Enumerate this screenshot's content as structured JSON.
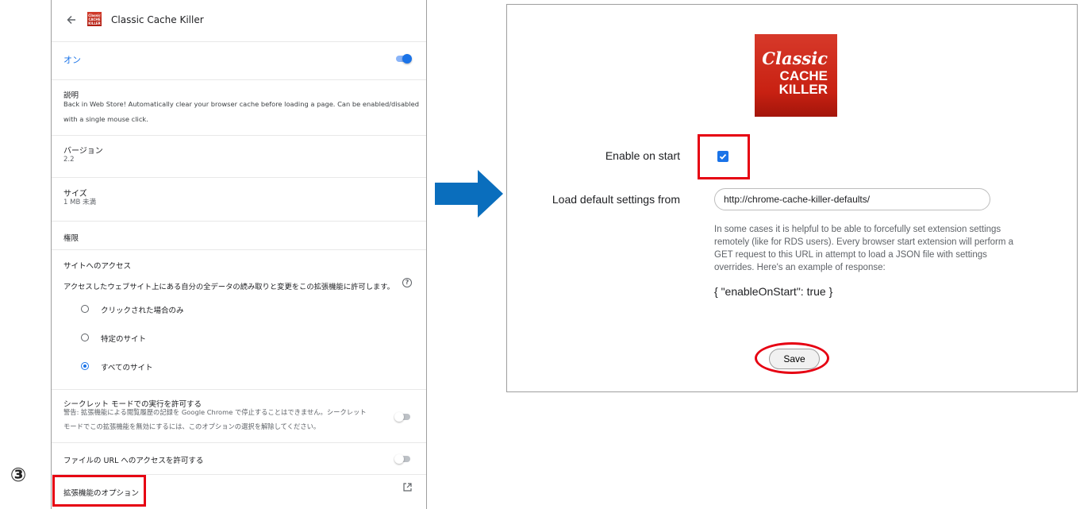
{
  "left": {
    "title": "Classic Cache Killer",
    "icon_text": [
      "Classic",
      "CACHE",
      "KILLER"
    ],
    "on_label": "オン",
    "description_heading": "説明",
    "description_text": [
      "Back in Web Store! Automatically clear your browser cache before loading a page. Can be enabled/disabled",
      "with a single mouse click."
    ],
    "version_heading": "バージョン",
    "version_value": "2.2",
    "size_heading": "サイズ",
    "size_value": "1 MB 未満",
    "permissions_heading": "権限",
    "site_access_heading": "サイトへのアクセス",
    "site_access_text": "アクセスしたウェブサイト上にある自分の全データの読み取りと変更をこの拡張機能に許可します。",
    "help_icon_glyph": "?",
    "radio_options": [
      "クリックされた場合のみ",
      "特定のサイト",
      "すべてのサイト"
    ],
    "radio_selected_index": 2,
    "incognito_heading": "シークレット モードでの実行を許可する",
    "incognito_text": [
      "警告: 拡張機能による閲覧履歴の記録を Google Chrome で停止することはできません。シークレット",
      "モードでこの拡張機能を無効にするには、このオプションの選択を解除してください。"
    ],
    "file_url_label": "ファイルの URL へのアクセスを許可する",
    "extension_options_label": "拡張機能のオプション",
    "step_marker": "③",
    "toggle_states": {
      "enabled": true,
      "incognito": false,
      "file_url": false
    }
  },
  "right": {
    "logo_line1": "Classic",
    "logo_line2": "CACHE",
    "logo_line3": "KILLER",
    "enable_on_start_label": "Enable on start",
    "enable_on_start_checked": true,
    "load_default_label": "Load default settings from",
    "load_default_value": "http://chrome-cache-killer-defaults/",
    "help_text": [
      "In some cases it is helpful to be able to forcefully set extension settings",
      "remotely (like for RDS users). Every browser start extension will perform a",
      "GET request to this URL in attempt to load a JSON file with settings",
      "overrides. Here's an example of response:"
    ],
    "json_example": "{ \"enableOnStart\": true }",
    "save_label": "Save"
  },
  "colors": {
    "accent_blue": "#1a73e8",
    "highlight_red": "#e60012",
    "arrow_blue": "#0a6ebd",
    "logo_red": "#c82112"
  }
}
